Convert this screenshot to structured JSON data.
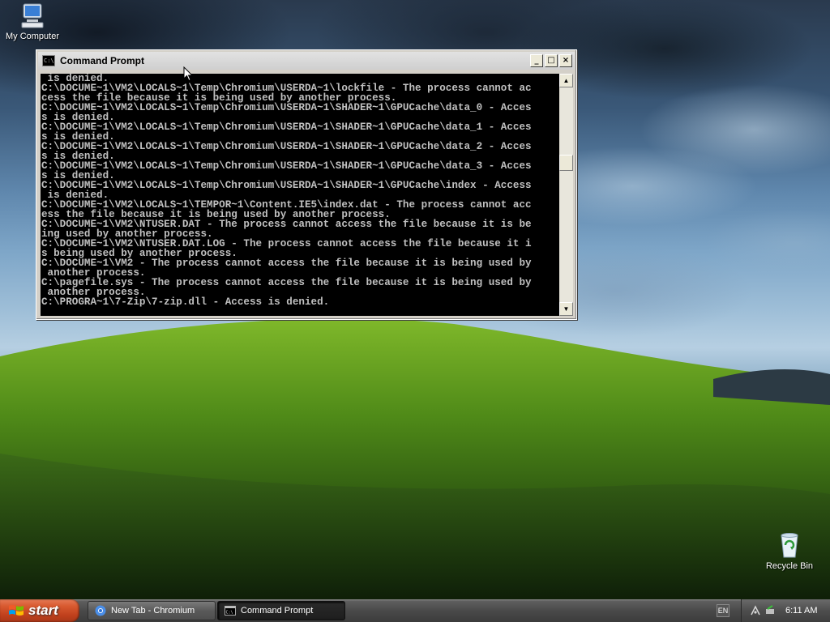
{
  "desktop": {
    "icons": [
      {
        "label": "My Computer",
        "icon": "my-computer-icon"
      },
      {
        "label": "Recycle Bin",
        "icon": "recycle-bin-icon"
      }
    ]
  },
  "window": {
    "title": "Command Prompt",
    "minimize": "_",
    "maximize": "□",
    "close": "×",
    "lines": [
      " is denied.",
      "C:\\DOCUME~1\\VM2\\LOCALS~1\\Temp\\Chromium\\USERDA~1\\lockfile - The process cannot ac",
      "cess the file because it is being used by another process.",
      "C:\\DOCUME~1\\VM2\\LOCALS~1\\Temp\\Chromium\\USERDA~1\\SHADER~1\\GPUCache\\data_0 - Acces",
      "s is denied.",
      "C:\\DOCUME~1\\VM2\\LOCALS~1\\Temp\\Chromium\\USERDA~1\\SHADER~1\\GPUCache\\data_1 - Acces",
      "s is denied.",
      "C:\\DOCUME~1\\VM2\\LOCALS~1\\Temp\\Chromium\\USERDA~1\\SHADER~1\\GPUCache\\data_2 - Acces",
      "s is denied.",
      "C:\\DOCUME~1\\VM2\\LOCALS~1\\Temp\\Chromium\\USERDA~1\\SHADER~1\\GPUCache\\data_3 - Acces",
      "s is denied.",
      "C:\\DOCUME~1\\VM2\\LOCALS~1\\Temp\\Chromium\\USERDA~1\\SHADER~1\\GPUCache\\index - Access",
      " is denied.",
      "C:\\DOCUME~1\\VM2\\LOCALS~1\\TEMPOR~1\\Content.IE5\\index.dat - The process cannot acc",
      "ess the file because it is being used by another process.",
      "C:\\DOCUME~1\\VM2\\NTUSER.DAT - The process cannot access the file because it is be",
      "ing used by another process.",
      "C:\\DOCUME~1\\VM2\\NTUSER.DAT.LOG - The process cannot access the file because it i",
      "s being used by another process.",
      "C:\\DOCUME~1\\VM2 - The process cannot access the file because it is being used by",
      " another process.",
      "C:\\pagefile.sys - The process cannot access the file because it is being used by",
      " another process.",
      "C:\\PROGRA~1\\7-Zip\\7-zip.dll - Access is denied."
    ]
  },
  "taskbar": {
    "start_label": "start",
    "tasks": [
      {
        "label": "New Tab - Chromium",
        "icon": "chromium-icon",
        "active": false
      },
      {
        "label": "Command Prompt",
        "icon": "cmd-icon",
        "active": true
      }
    ],
    "language": "EN",
    "clock": "6:11 AM"
  }
}
